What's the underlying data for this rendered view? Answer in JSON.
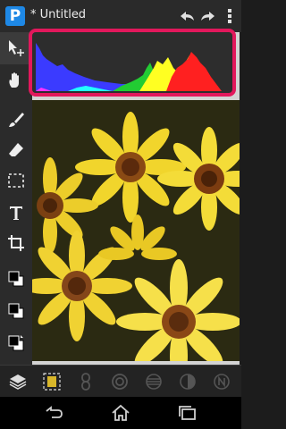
{
  "app": {
    "logo_letter": "P",
    "title_prefix": "*",
    "document_title": "Untitled"
  },
  "toolbar_top": {
    "icons": [
      "undo-icon",
      "redo-icon",
      "overflow-menu-icon"
    ]
  },
  "sidebar": {
    "tools": [
      {
        "name": "move-tool",
        "icon": "move-arrow-icon"
      },
      {
        "name": "hand-tool",
        "icon": "hand-icon"
      },
      {
        "name": "brush-tool",
        "icon": "brush-icon"
      },
      {
        "name": "eraser-tool",
        "icon": "eraser-icon"
      },
      {
        "name": "selection-tool",
        "icon": "dashed-rect-icon"
      },
      {
        "name": "text-tool",
        "icon": "text-t-icon",
        "label": "T"
      },
      {
        "name": "crop-tool",
        "icon": "crop-icon"
      },
      {
        "name": "color-swatch-1",
        "icon": "black-white-swatch-icon"
      },
      {
        "name": "color-swatch-2",
        "icon": "black-white-swatch-icon"
      },
      {
        "name": "color-swatch-3",
        "icon": "swap-swatch-icon"
      }
    ]
  },
  "histogram": {
    "channels": [
      "blue",
      "green",
      "red",
      "yellow"
    ],
    "colors": {
      "blue": "#3b3bff",
      "green": "#22cc33",
      "red": "#ff2020",
      "yellow": "#ffff22",
      "cyan": "#22ffff",
      "magenta": "#ff33ff",
      "highlight_border": "#e2185c"
    }
  },
  "bottom_bar": {
    "icons": [
      "layers-icon",
      "image-frame-icon",
      "chain-link-icon",
      "circle-target-icon",
      "striped-circle-icon",
      "half-circle-icon",
      "n-badge-icon"
    ]
  },
  "navbar": {
    "icons": [
      "back-icon",
      "home-icon",
      "recent-apps-icon"
    ]
  }
}
